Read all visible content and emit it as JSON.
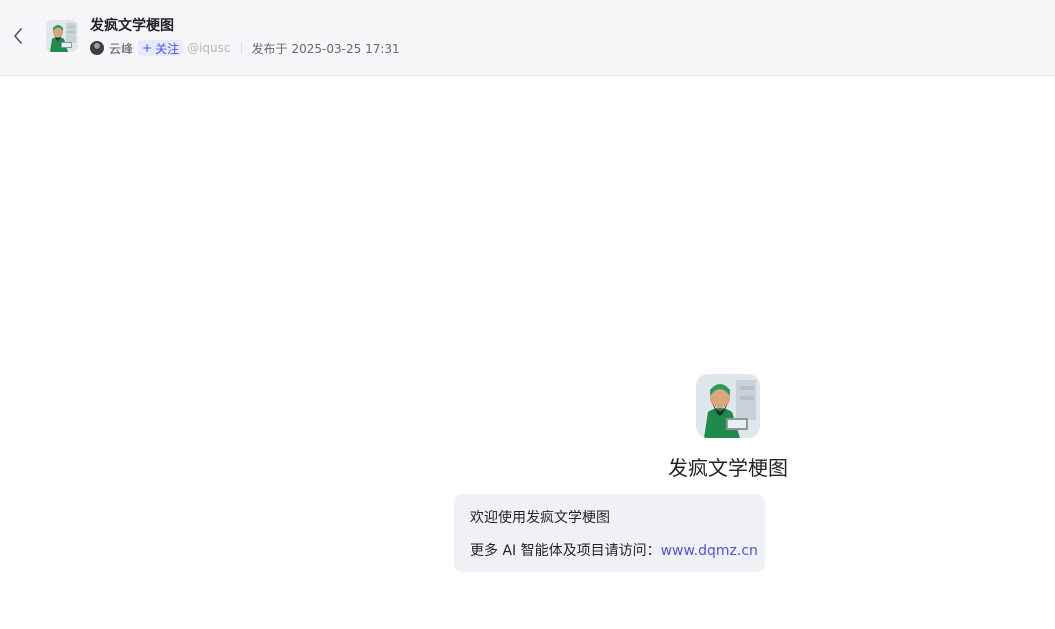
{
  "header": {
    "back_icon": "chevron-left-icon",
    "title": "发疯文学梗图",
    "author_name": "云峰",
    "follow_label": "关注",
    "follow_icon": "plus-icon",
    "handle": "@iqusc",
    "published_label": "发布于",
    "published_time": "2025-03-25 17:31"
  },
  "bot": {
    "name": "发疯文学梗图"
  },
  "welcome": {
    "line1": "欢迎使用发疯文学梗图",
    "line2_prefix": "更多 AI 智能体及项目请访问：",
    "link_text": "www.dqmz.cn"
  },
  "colors": {
    "accent": "#4d53e8",
    "header_bg": "#f6f6f8",
    "bubble_bg": "#f0f1f5"
  }
}
